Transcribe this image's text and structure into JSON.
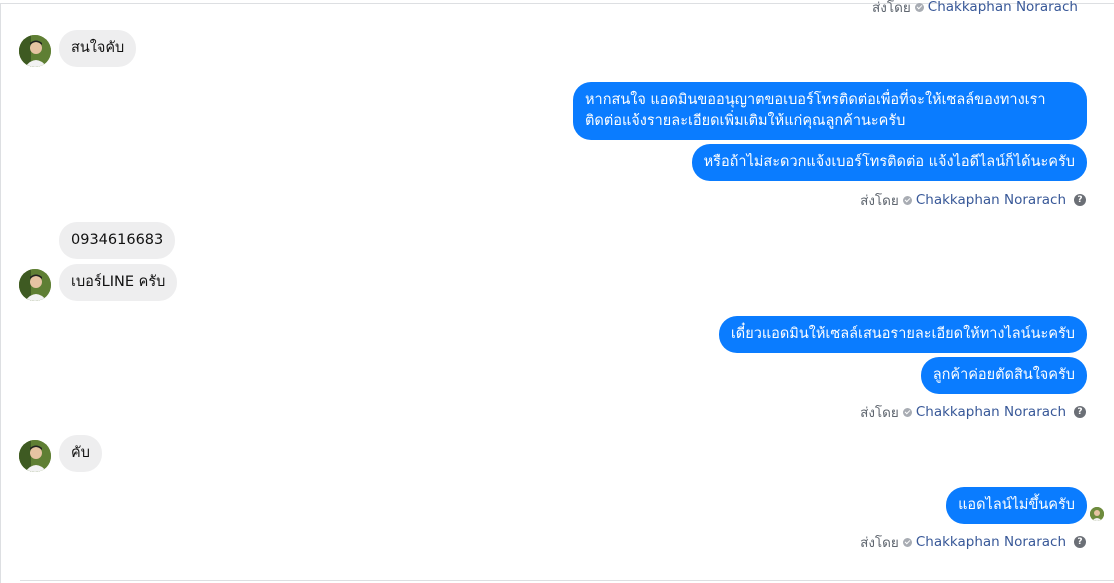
{
  "conversation": {
    "sender_prefix": "ส่งโดย",
    "agent_name": "Chakkaphan Norarach",
    "help_glyph": "?",
    "messages": [
      {
        "text": "สนใจคับ"
      },
      {
        "text_line1": "หากสนใจ แอดมินขออนุญาตขอเบอร์โทรติดต่อเพื่อที่จะให้เซลล์ของทางเรา",
        "text_line2": "ติดต่อแจ้งรายละเอียดเพิ่มเติมให้แก่คุณลูกค้านะครับ"
      },
      {
        "text": "หรือถ้าไม่สะดวกแจ้งเบอร์โทรติดต่อ แจ้งไอดีไลน์ก็ได้นะครับ"
      },
      {
        "text": "0934616683"
      },
      {
        "text": "เบอร์LINE ครับ"
      },
      {
        "text": "เดี๋ยวแอดมินให้เซลล์เสนอรายละเอียดให้ทางไลน์นะครับ"
      },
      {
        "text": "ลูกค้าค่อยตัดสินใจครับ"
      },
      {
        "text": "คับ"
      },
      {
        "text": "แอดไลน์ไม่ขึ้นครับ"
      }
    ]
  },
  "colors": {
    "outgoing_bubble": "#0a7cff",
    "incoming_bubble": "#eeeeef",
    "agent_name": "#385898"
  }
}
